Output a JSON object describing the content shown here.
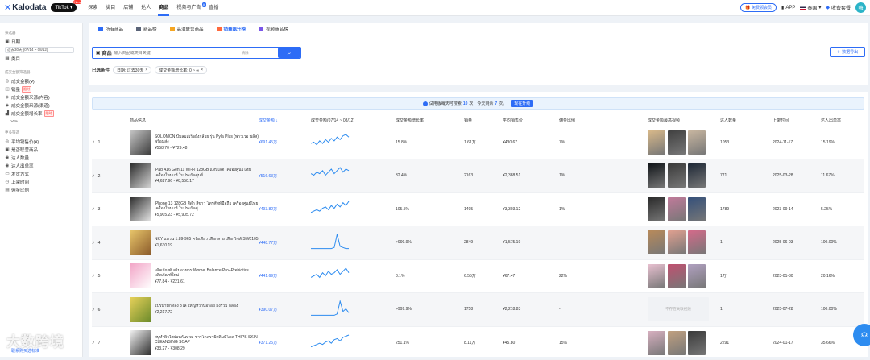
{
  "brand": {
    "name": "Kalodata",
    "platform": "TikTok",
    "platform_badge": "New"
  },
  "nav": [
    "探索",
    "类目",
    "店铺",
    "达人",
    "商品",
    "视频与广告",
    "直播"
  ],
  "nav_badge": "AI",
  "top_right": {
    "free_member": "免费领会员",
    "app": "APP",
    "region": "泰国",
    "pricing": "收费套餐",
    "avatar": "嗨"
  },
  "sidebar": {
    "filter_title": "筛选器",
    "date_label": "日期",
    "date_value": "过去30天 (07/14 ~ 08/12)",
    "category_label": "类目",
    "metric_title": "成交金额筛选器",
    "metric_items": [
      "成交金额(¥)",
      "销量",
      "成交金额来源(内容)",
      "成交金额来源(渠道)",
      "成交金额增长率"
    ],
    "hot_tag": "限时",
    "growth_value": ">0%",
    "more_title": "更多筛选",
    "more_items": [
      "平均销售价(¥)",
      "是否联营商品",
      "达人数量",
      "达人出单率",
      "发货方式",
      "上架时间",
      "佣金比例"
    ]
  },
  "tabs": [
    "所有商品",
    "新品榜",
    "高潜联营商品",
    "销量飙升榜",
    "视频商品榜"
  ],
  "search": {
    "label": "商品",
    "placeholder": "输入商品或类目关键",
    "clear": "清除"
  },
  "export_label": "数据导出",
  "conditions": {
    "label": "已选条件",
    "chips": [
      "日期: 过去30天",
      "成交金额增长率: 0 ~ ∞"
    ]
  },
  "notice": {
    "prefix": "试用版每天可搜索",
    "count": "10",
    "mid": "次，今天剩余",
    "remain": "7",
    "suffix": "次。",
    "button": "现在升级"
  },
  "columns": [
    "商品信息",
    "成交金额 ↓",
    "成交金额(07/14 ~ 08/12)",
    "成交金额增长率",
    "销量",
    "平均销售价",
    "佣金比例",
    "成交金额最高视频",
    "达人数量",
    "上架时间",
    "达人出单率"
  ],
  "rows": [
    {
      "idx": "1",
      "name": "SOLOMON ปั๊มลมสเร็จยังกล้วย รุ่น Pyla Plus (พาวเวอ พลัส) พร้อมส่ง",
      "price": "¥558.70 - ¥729.48",
      "amount": "¥691.45万",
      "growth": "15.8%",
      "sales": "1.61万",
      "avg": "¥430.67",
      "comm": "7%",
      "creators": "1053",
      "date": "2024-11-17",
      "rate": "15.19%",
      "spark": [
        5,
        6,
        4,
        7,
        5,
        8,
        6,
        9,
        7,
        10,
        8,
        11,
        12,
        10
      ]
    },
    {
      "idx": "2",
      "name": "iPad A16 Gen 11 Wi-Fi 128GB แท็บเล็ต เครื่องศูนย์ไทย เครื่องใหม่แท้ ใบประกันศูนย์...",
      "price": "¥4,627.96 - ¥8,550.17",
      "amount": "¥516.63万",
      "growth": "32.4%",
      "sales": "2163",
      "avg": "¥2,388.51",
      "comm": "1%",
      "creators": "771",
      "date": "2025-03-28",
      "rate": "11.67%",
      "spark": [
        6,
        5,
        7,
        6,
        8,
        5,
        7,
        9,
        6,
        8,
        10,
        7,
        9,
        8
      ]
    },
    {
      "idx": "3",
      "name": "iPhone 13 128GB สีดำ สีขาว โทรศัพท์มือถือ เครื่องศูนย์ไทย เครื่องใหม่แท้ ใบประกันศู...",
      "price": "¥5,905.23 - ¥5,905.72",
      "amount": "¥493.82万",
      "growth": "105.5%",
      "sales": "1495",
      "avg": "¥3,303.12",
      "comm": "1%",
      "creators": "1789",
      "date": "2023-09-14",
      "rate": "5.25%",
      "spark": [
        3,
        4,
        5,
        4,
        6,
        7,
        5,
        8,
        6,
        9,
        7,
        10,
        8,
        11
      ]
    },
    {
      "idx": "4",
      "name": "NKY แหวน 1.89-965 ครั้งเดียว เลือกลาย เลือกไซส์ SW0105",
      "price": "¥1,630.19",
      "amount": "¥448.77万",
      "growth": ">999.9%",
      "sales": "2849",
      "avg": "¥1,575.19",
      "comm": "-",
      "creators": "1",
      "date": "2025-06-03",
      "rate": "100.00%",
      "spark": [
        1,
        1,
        1,
        1,
        1,
        1,
        1,
        1,
        2,
        14,
        3,
        2,
        1,
        1
      ]
    },
    {
      "idx": "5",
      "name": "ผลิตภัณฑ์เสริมอาหาร Wome' Balance Pro+Prebiotics ผลิตภัณฑ์ใหม่",
      "price": "¥77.84 - ¥221.61",
      "amount": "¥441.69万",
      "growth": "8.1%",
      "sales": "6.55万",
      "avg": "¥67.47",
      "comm": "22%",
      "creators": "1万",
      "date": "2023-01-30",
      "rate": "20.16%",
      "spark": [
        4,
        5,
        6,
        4,
        7,
        5,
        8,
        6,
        7,
        9,
        6,
        8,
        10,
        7
      ]
    },
    {
      "idx": "6",
      "name": "โปรนาทักทอง 3โล ใหญ่หวานอร่อย ยังรวม กล่อง",
      "price": "¥2,217.72",
      "amount": "¥390.07万",
      "growth": ">999.9%",
      "sales": "1758",
      "avg": "¥2,218.83",
      "comm": "-",
      "creators": "1",
      "date": "2025-07-28",
      "rate": "100.00%",
      "na": "不存在关联视频",
      "spark": [
        1,
        1,
        1,
        1,
        1,
        1,
        1,
        1,
        1,
        2,
        12,
        4,
        6,
        3
      ]
    },
    {
      "idx": "7",
      "name": "สบู่ทำผิวใสผ่อนกันบวม ชาร์โคลรามิสลิมมิ์โดด THIPS SKIN CLEANSING SOAP",
      "price": "¥33.27 - ¥308.29",
      "amount": "¥371.25万",
      "growth": "251.1%",
      "sales": "8.11万",
      "avg": "¥45.80",
      "comm": "15%",
      "creators": "2291",
      "date": "2024-01-17",
      "rate": "35.66%",
      "spark": [
        3,
        4,
        5,
        6,
        5,
        7,
        8,
        6,
        9,
        10,
        8,
        11,
        12,
        13
      ]
    }
  ],
  "watermark": "大数跨境",
  "watermark_sub": "联系购买选标准",
  "cs_icon": "headset-icon"
}
